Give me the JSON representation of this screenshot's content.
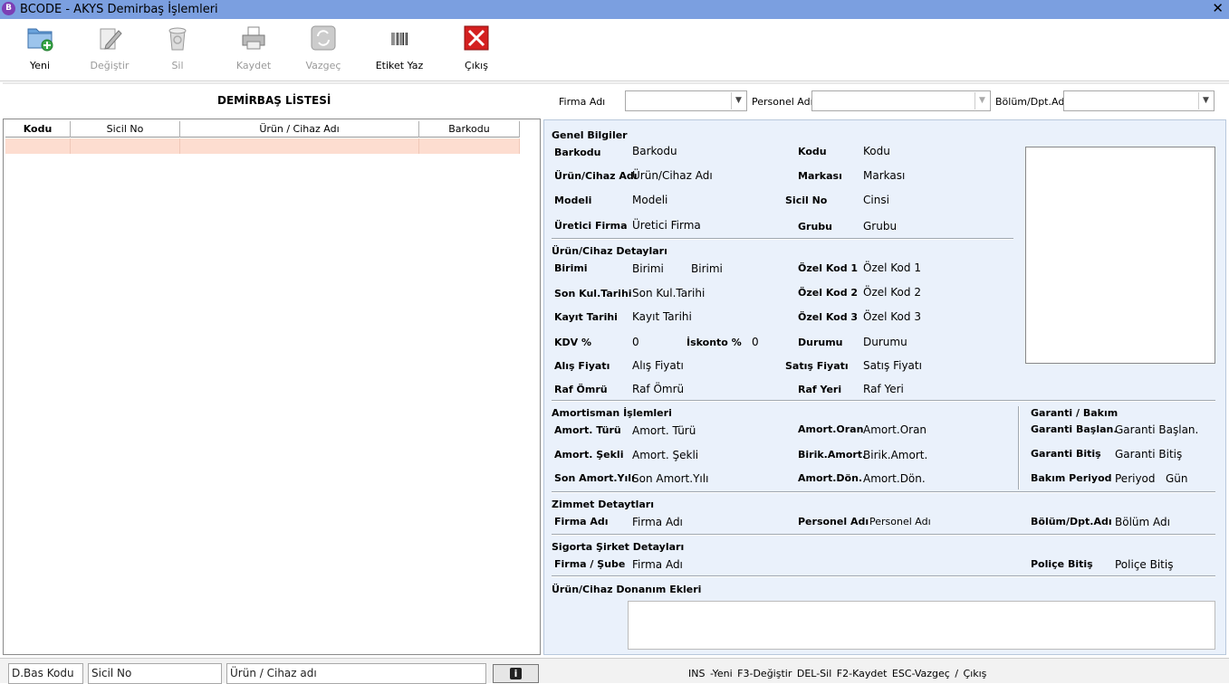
{
  "window": {
    "title": "BCODE - AKYS Demirbaş İşlemleri",
    "icon_letter": "B",
    "close_glyph": "✕"
  },
  "toolbar": {
    "buttons": [
      {
        "label": "Yeni",
        "icon": "new-folder-icon",
        "enabled": true
      },
      {
        "label": "Değiştir",
        "icon": "edit-pen-icon",
        "enabled": false
      },
      {
        "label": "Sil",
        "icon": "recycle-bin-icon",
        "enabled": false
      },
      {
        "label": "Kaydet",
        "icon": "printer-save-icon",
        "enabled": false
      },
      {
        "label": "Vazgeç",
        "icon": "refresh-icon",
        "enabled": false
      },
      {
        "label": "Etiket Yaz",
        "icon": "barcode-icon",
        "enabled": true
      },
      {
        "label": "Çıkış",
        "icon": "exit-x-icon",
        "enabled": true
      }
    ]
  },
  "filters": {
    "list_title": "DEMİRBAŞ LİSTESİ",
    "firma_label": "Firma Adı",
    "personel_label": "Personel Adı",
    "bolum_label": "Bölüm/Dpt.Adı"
  },
  "grid": {
    "columns": [
      "Kodu",
      "Sicil No",
      "Ürün / Cihaz Adı",
      "Barkodu"
    ]
  },
  "details": {
    "genel": {
      "title": "Genel Bilgiler",
      "barkodu_label": "Barkodu",
      "barkodu_value": "Barkodu",
      "kodu_label": "Kodu",
      "kodu_value": "Kodu",
      "urun_label": "Ürün/Cihaz Adı",
      "urun_value": "Ürün/Cihaz Adı",
      "markasi_label": "Markası",
      "markasi_value": "Markası",
      "modeli_label": "Modeli",
      "modeli_value": "Modeli",
      "sicil_label": "Sicil No",
      "sicil_value": "Cinsi",
      "uretici_label": "Üretici Firma",
      "uretici_value": "Üretici Firma",
      "grubu_label": "Grubu",
      "grubu_value": "Grubu"
    },
    "detay": {
      "title": "Ürün/Cihaz Detayları",
      "birimi_label": "Birimi",
      "birimi_value1": "Birimi",
      "birimi_value2": "Birimi",
      "ozel1_label": "Özel Kod 1",
      "ozel1_value": "Özel Kod 1",
      "sonkul_label": "Son Kul.Tarihi",
      "sonkul_value": "Son Kul.Tarihi",
      "ozel2_label": "Özel Kod 2",
      "ozel2_value": "Özel Kod 2",
      "kayit_label": "Kayıt Tarihi",
      "kayit_value": "Kayıt Tarihi",
      "ozel3_label": "Özel Kod 3",
      "ozel3_value": "Özel Kod 3",
      "kdv_label": "KDV %",
      "kdv_value": "0",
      "iskonto_label": "İskonto %",
      "iskonto_value": "0",
      "durumu_label": "Durumu",
      "durumu_value": "Durumu",
      "alis_label": "Alış Fiyatı",
      "alis_value": "Alış Fiyatı",
      "satis_label": "Satış Fiyatı",
      "satis_value": "Satış Fiyatı",
      "raf_omru_label": "Raf Ömrü",
      "raf_omru_value": "Raf Ömrü",
      "raf_yeri_label": "Raf Yeri",
      "raf_yeri_value": "Raf Yeri"
    },
    "amortisman": {
      "title": "Amortisman İşlemleri",
      "turu_label": "Amort. Türü",
      "turu_value": "Amort. Türü",
      "oran_label": "Amort.Oran",
      "oran_value": "Amort.Oran",
      "sekli_label": "Amort. Şekli",
      "sekli_value": "Amort. Şekli",
      "birik_label": "Birik.Amort.",
      "birik_value": "Birik.Amort.",
      "yili_label": "Son Amort.Yılı",
      "yili_value": "Son Amort.Yılı",
      "don_label": "Amort.Dön.",
      "don_value": "Amort.Dön."
    },
    "garanti": {
      "title": "Garanti / Bakım",
      "baslan_label": "Garanti Başlan.",
      "baslan_value": "Garanti Başlan.",
      "bitis_label": "Garanti Bitiş",
      "bitis_value": "Garanti Bitiş",
      "periyod_label": "Bakım Periyod",
      "periyod_value": "Periyod",
      "periyod_unit": "Gün"
    },
    "zimmet": {
      "title": "Zimmet Detaytları",
      "firma_label": "Firma Adı",
      "firma_value": "Firma Adı",
      "personel_label": "Personel Adı",
      "personel_value": "Personel Adı",
      "bolum_label": "Bölüm/Dpt.Adı",
      "bolum_value": "Bölüm Adı"
    },
    "sigorta": {
      "title": "Sigorta Şirket Detayları",
      "firma_label": "Firma / Şube",
      "firma_value": "Firma Adı",
      "police_label": "Poliçe Bitiş",
      "police_value": "Poliçe Bitiş"
    },
    "donanim": {
      "title": "Ürün/Cihaz Donanım Ekleri"
    }
  },
  "bottom": {
    "dbas_placeholder": "D.Bas Kodu",
    "sicil_placeholder": "Sicil No",
    "urun_placeholder": "Ürün / Cihaz adı",
    "info_glyph": "i",
    "shortcuts": "INS -Yeni   F3-Değiştir   DEL-Sil   F2-Kaydet  ESC-Vazgeç / Çıkış"
  },
  "colors": {
    "titlebar": "#7b9fe0",
    "panel": "#eaf1fb",
    "selected_row": "#fdddd0",
    "exit": "#d42020"
  }
}
